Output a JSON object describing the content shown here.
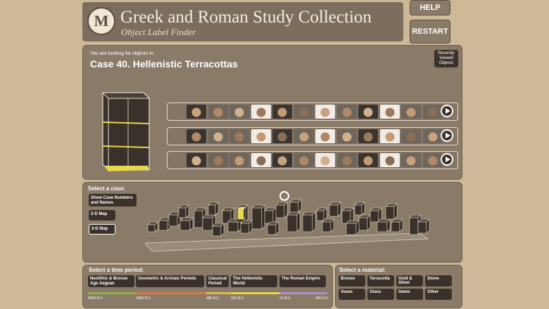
{
  "header": {
    "logo_text": "M",
    "title": "Greek and Roman Study Collection",
    "subtitle": "Object Label Finder"
  },
  "buttons": {
    "help": "HELP",
    "restart": "RESTART"
  },
  "main": {
    "looking_label": "You are looking for objects in:",
    "case_title": "Case 40. Hellenistic Terracottas",
    "recently_viewed": "Recently Viewed Objects"
  },
  "case_selector": {
    "label": "Select a case:",
    "show_numbers": "Show Case Numbers and Names",
    "map_2d": "2-D Map",
    "map_3d": "3-D Map"
  },
  "time_period": {
    "label": "Select a time period:",
    "periods": [
      "Neolithic & Bronze Age Aegean",
      "Geometric & Archaic Periods",
      "Classical Period",
      "The Hellenistic World",
      "The Roman Empire"
    ],
    "ticks": [
      "6000 B.C.",
      "1050 B.C.",
      "480 B.C.",
      "323 B.C.",
      "31 B.C.",
      "330 A.D."
    ],
    "colors": [
      "#8fb04a",
      "#d9774a",
      "#e0b84a",
      "#e6d840",
      "#b08cc8"
    ]
  },
  "material": {
    "label": "Select a material:",
    "items": [
      "Bronze",
      "Terracotta",
      "Gold & Silver",
      "Stone",
      "Vases",
      "Glass",
      "Gems",
      "Other"
    ]
  },
  "thumbnail_rows": [
    [
      "head",
      "figure",
      "head",
      "head",
      "head",
      "head",
      "head",
      "figure",
      "head",
      "figure",
      "vase",
      "head"
    ],
    [
      "relief",
      "figure",
      "figure",
      "figure",
      "figure",
      "figure",
      "relief",
      "head",
      "head",
      "disc",
      "disc",
      "figure"
    ],
    [
      "head",
      "head",
      "head",
      "head",
      "head",
      "head",
      "head",
      "head",
      "head",
      "head",
      "head",
      "head"
    ]
  ]
}
